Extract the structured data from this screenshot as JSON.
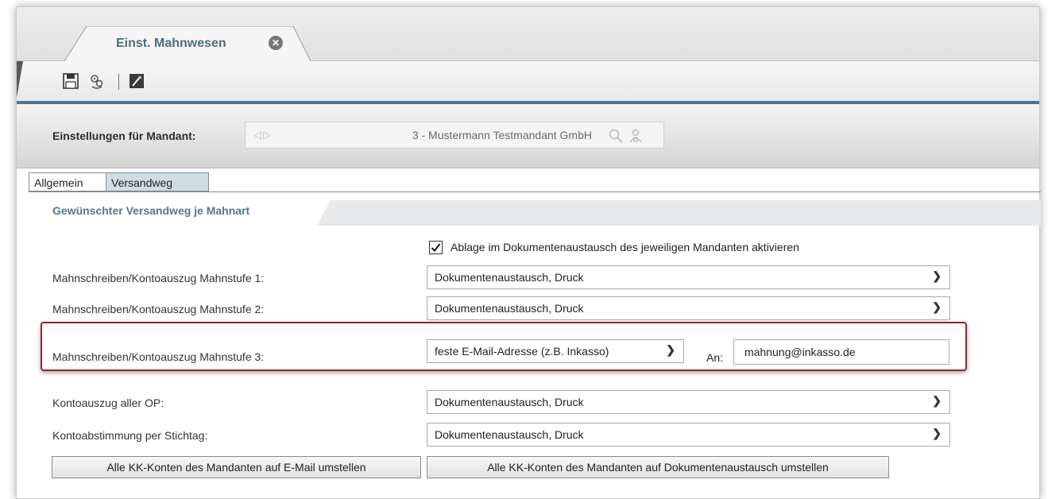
{
  "document_tab": {
    "label": "Einst. Mahnwesen",
    "close_icon": "close-circle-icon"
  },
  "toolbar": {
    "icons": [
      "save-icon",
      "settings-reset-icon",
      "edit-icon"
    ]
  },
  "header": {
    "mandant_label": "Einstellungen für Mandant:",
    "mandant_value": "3 - Mustermann Testmandant GmbH",
    "icons": [
      "search-icon",
      "users-icon"
    ]
  },
  "tabs": [
    {
      "label": "Allgemein",
      "active": false
    },
    {
      "label": "Versandweg",
      "active": true
    }
  ],
  "section": {
    "title": "Gewünschter Versandweg je Mahnart"
  },
  "form": {
    "archive_checkbox": {
      "label": "Ablage im Dokumentenaustausch des jeweiligen Mandanten aktivieren",
      "checked": true
    },
    "rows": [
      {
        "label": "Mahnschreiben/Kontoauszug Mahnstufe 1:",
        "value": "Dokumentenaustausch, Druck"
      },
      {
        "label": "Mahnschreiben/Kontoauszug Mahnstufe 2:",
        "value": "Dokumentenaustausch, Druck"
      },
      {
        "label": "Mahnschreiben/Kontoauszug Mahnstufe 3:",
        "value": "feste E-Mail-Adresse (z.B. Inkasso)",
        "to_label": "An:",
        "to_value": "mahnung@inkasso.de"
      },
      {
        "label": "Kontoauszug aller OP:",
        "value": "Dokumentenaustausch, Druck"
      },
      {
        "label": "Kontoabstimmung per Stichtag:",
        "value": "Dokumentenaustausch, Druck"
      }
    ]
  },
  "buttons": {
    "email_all": "Alle KK-Konten des Mandanten auf E-Mail umstellen",
    "docexchange_all": "Alle KK-Konten des Mandanten auf Dokumentenaustausch umstellen"
  },
  "colors": {
    "accent": "#4d7488",
    "highlight_border": "#8b2a2a",
    "active_tab": "#cddde3"
  }
}
